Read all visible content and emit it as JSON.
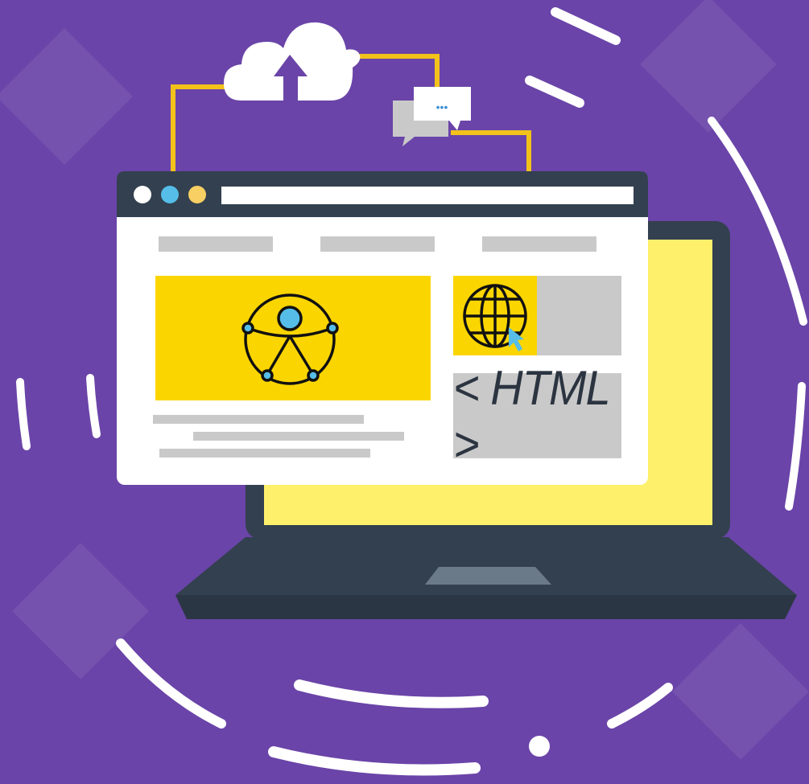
{
  "illustration": {
    "code_tag": "< HTML >",
    "chat_bubble_dots": "•••"
  },
  "colors": {
    "background": "#6a44a8",
    "laptop_dark": "#33404f",
    "laptop_screen": "#fff06b",
    "browser_white": "#ffffff",
    "accent_yellow": "#fbd500",
    "gray_block": "#c9c9c9",
    "dot_white": "#ffffff",
    "dot_blue": "#55bde8",
    "dot_yellow": "#f7cf63",
    "wire_yellow": "#f2c21b"
  },
  "icons": {
    "cloud": "cloud-upload-icon",
    "chat": "chat-bubbles-icon",
    "accessibility": "universal-access-icon",
    "globe": "globe-icon",
    "cursor": "cursor-arrow-icon"
  }
}
